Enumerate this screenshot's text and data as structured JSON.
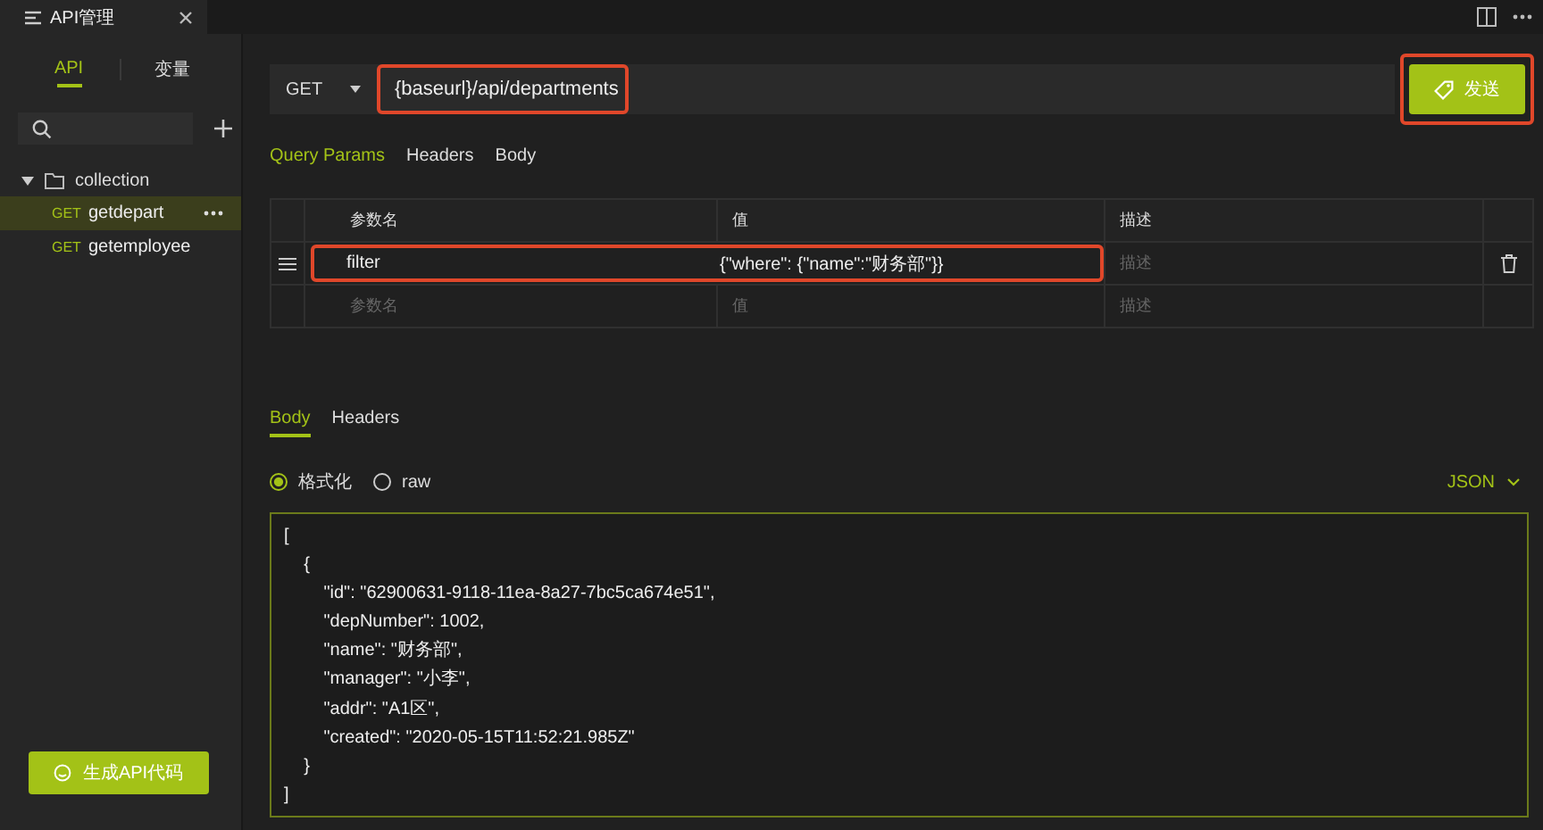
{
  "window_tab": {
    "title": "API管理"
  },
  "sidebar": {
    "tabs": [
      {
        "label": "API",
        "selected": true
      },
      {
        "label": "变量",
        "selected": false
      }
    ],
    "tree": [
      {
        "label": "collection",
        "expanded": true,
        "children": [
          {
            "method": "GET",
            "label": "getdepart",
            "selected": true
          },
          {
            "method": "GET",
            "label": "getemployee",
            "selected": false
          }
        ]
      }
    ],
    "generate_button": "生成API代码"
  },
  "request": {
    "method": "GET",
    "url": "{baseurl}/api/departments",
    "send_button": "发送"
  },
  "request_tabs": [
    {
      "label": "Query Params",
      "selected": true
    },
    {
      "label": "Headers",
      "selected": false
    },
    {
      "label": "Body",
      "selected": false
    }
  ],
  "params": {
    "columns": [
      "参数名",
      "值",
      "描述"
    ],
    "rows": [
      {
        "name": "filter",
        "value": "{\"where\": {\"name\":\"财务部\"}}",
        "description_placeholder": "描述"
      }
    ],
    "new_row": {
      "name_placeholder": "参数名",
      "value_placeholder": "值",
      "description_placeholder": "描述"
    }
  },
  "response_tabs": [
    {
      "label": "Body",
      "selected": true
    },
    {
      "label": "Headers",
      "selected": false
    }
  ],
  "format_options": [
    {
      "label": "格式化",
      "selected": true
    },
    {
      "label": "raw",
      "selected": false
    }
  ],
  "language": "JSON",
  "body_lines": [
    "[",
    "    {",
    "        \"id\": \"62900631-9118-11ea-8a27-7bc5ca674e51\",",
    "        \"depNumber\": 1002,",
    "        \"name\": \"财务部\",",
    "        \"manager\": \"小李\",",
    "        \"addr\": \"A1区\",",
    "        \"created\": \"2020-05-15T11:52:21.985Z\"",
    "    }",
    "]"
  ]
}
